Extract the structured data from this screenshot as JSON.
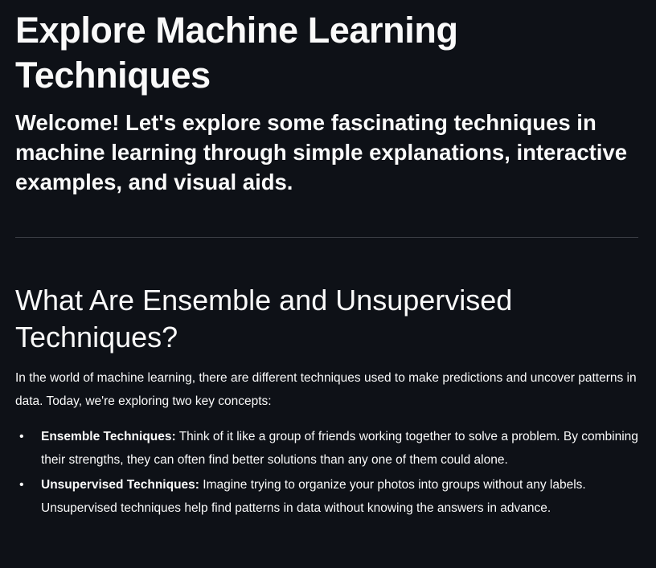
{
  "header": {
    "title": "Explore Machine Learning Techniques",
    "subtitle": "Welcome! Let's explore some fascinating techniques in machine learning through simple explanations, interactive examples, and visual aids."
  },
  "section": {
    "heading": "What Are Ensemble and Unsupervised Techniques?",
    "intro": "In the world of machine learning, there are different techniques used to make predictions and uncover patterns in data. Today, we're exploring two key concepts:",
    "items": [
      {
        "term": "Ensemble Techniques:",
        "text": " Think of it like a group of friends working together to solve a problem. By combining their strengths, they can often find better solutions than any one of them could alone."
      },
      {
        "term": "Unsupervised Techniques:",
        "text": " Imagine trying to organize your photos into groups without any labels. Unsupervised techniques help find patterns in data without knowing the answers in advance."
      }
    ]
  },
  "colors": {
    "background": "#0e1117",
    "text": "#fafafa",
    "divider": "#3a3d45"
  }
}
